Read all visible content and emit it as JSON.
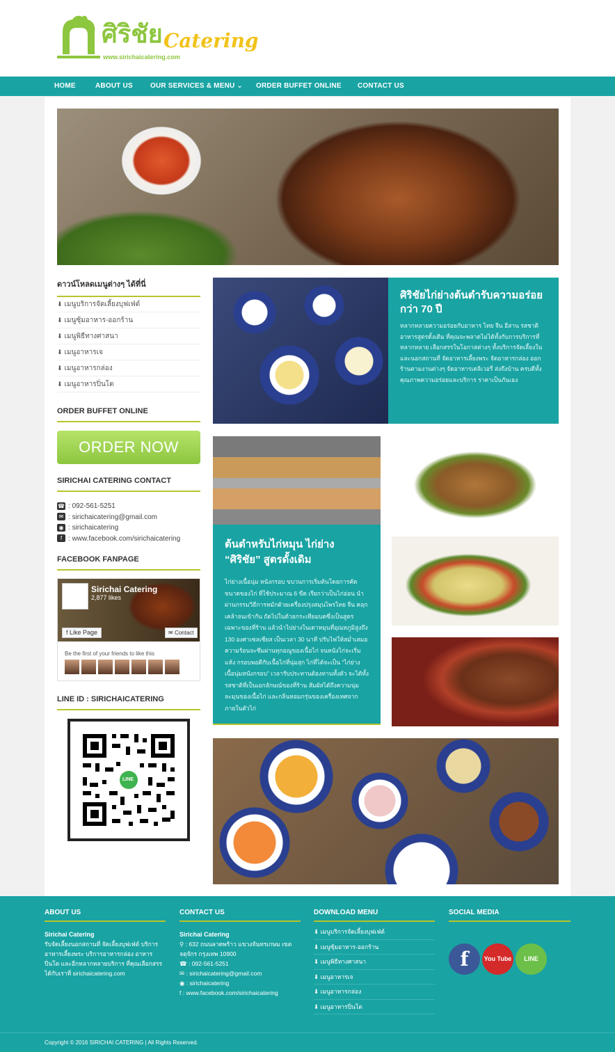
{
  "logo": {
    "thai": "ศิริชัย",
    "english": "Catering",
    "url": "www.sirichaicatering.com"
  },
  "nav": [
    {
      "label": "HOME"
    },
    {
      "label": "ABOUT US"
    },
    {
      "label": "OUR SERVICES & MENU",
      "caret": "⌄"
    },
    {
      "label": "ORDER BUFFET ONLINE"
    },
    {
      "label": "CONTACT US"
    }
  ],
  "sidebar": {
    "download_heading": "ดาวน์โหลดเมนูต่างๆ ได้ที่นี่",
    "download_items": [
      "เมนูบริการจัดเลี้ยงบุฟเฟ่ต์",
      "เมนูซุ้มอาหาร-ออกร้าน",
      "เมนูพิธีทางศาสนา",
      "เมนูอาหารเจ",
      "เมนูอาหารกล่อง",
      "เมนูอาหารปิ่นโต"
    ],
    "order_heading": "ORDER BUFFET ONLINE",
    "order_button": "ORDER NOW",
    "contact_heading": "SIRICHAI CATERING CONTACT",
    "contact": {
      "phone": "092-561-5251",
      "email": "sirichaicatering@gmail.com",
      "line": "sirichaicatering",
      "facebook": "www.facebook.com/sirichaicatering"
    },
    "fanpage_heading": "FACEBOOK FANPAGE",
    "fanpage": {
      "name": "Sirichai Catering",
      "likes": "2,877 likes",
      "like_button": "Like Page",
      "contact_button": "Contact",
      "first_text": "Be the first of your friends to like this"
    },
    "line_heading": "LINE ID : SIRICHAICATERING",
    "qr_badge": "LINE"
  },
  "feature": {
    "title": "ศิริชัยไก่ย่างต้นตำรับความอร่อย กว่า 70 ปี",
    "text": "หลากหลายความอร่อยกับอาหาร ไทย จีน อีสาน รสชาติอาหารสูตรดั้งเดิม ที่คุณจะพลาดไม่ได้ทั้งกับการบริการที่หลากหลาย เลือกสรรในโอกาสต่างๆ ทั้งบริการจัดเลี้ยงในและนอกสถานที่ จัดอาหารเลี้ยงพระ จัดอาหารกล่อง ออกร้านตามงานต่างๆ จัดอาหารเดลิเวอรี่ ส่งถึงบ้าน ครบดีทั้งคุณภาพความอร่อยและบริการ ราคาเป็นกันเอง"
  },
  "chicken": {
    "title": "ต้นตำหรับไก่หมุน ไก่ย่าง “ศิริชัย” สูตรดั้งเดิม",
    "text": "ไก่ย่างเนื้อนุ่ม หนังกรอบ ขบวนการเริ่มต้นโดยการคัดขนาดของไก่ ที่ใช้ประมาณ 6 ขีด เรียกว่าเป็นไก่อ่อน นำผ่านกรรมวิธีการหมักด้วยเครื่องปรุงสมุนไพรไทย จีน คลุกเคล้าจนเข้ากัน ถัดไปในด้วยกระเทียมบดซึ่งเป็นสูตรเฉพาะของที่ร้าน แล้วนำไปย่างในเตาหมุนที่อุณหภูมิสูงถึง 130 องศาเซลเซียส เป็นเวลา 30 นาที ปรับไฟให้สม่ำเสมอ ความร้อนจะซึมผ่านทุกอณูของเนื้อไก่ จนหนังไก่จะเริ่มแห้ง กรอบพอดีกับเนื้อไก่ที่นุ่มสุก ไก่ที่ได้จะเป็น “ไก่ย่างเนื้อนุ่มหนังกรอบ” เวลารับประทานต้องทานทั้งตัว จะได้ทั้งรสชาติที่เป็นเอกลักษณ์ของที่ร้าน สัมผัสได้ถึงความนุ่มละมุนของเนื้อไก่ และกลิ่นหอมกรุ่นของเครื่องเทศจากภายในตัวไก่"
  },
  "footer": {
    "about_heading": "ABOUT US",
    "about_name": "Sirichai Catering",
    "about_text": "รับจัดเลี้ยงนอกสถานที่ จัดเลี้ยงบุฟเฟ่ต์ บริการอาหารเลี้ยงพระ บริการอาหารกล่อง อาหารปิ่นโต และอีกหลากหลายบริการ ที่คุณเลือกสรรได้กับเราที่ sirichaicatering.com",
    "contact_heading": "CONTACT US",
    "contact_name": "Sirichai Catering",
    "address": "632 ถนนลาดพร้าว แขวงจันทรเกษม เขตจตุจักร กรุงเทพ 10900",
    "phone": "092-561-5251",
    "email": "sirichaicatering@gmail.com",
    "line": "sirichaicatering",
    "facebook": "www.facebook.com/sirichaicatering",
    "download_heading": "DOWNLOAD MENU",
    "download_items": [
      "เมนูบริการจัดเลี้ยงบุฟเฟ่ต์",
      "เมนูซุ้มอาหาร-ออกร้าน",
      "เมนูพิธีทางศาสนา",
      "เมนูอาหารเจ",
      "เมนูอาหารกล่อง",
      "เมนูอาหารปิ่นโต"
    ],
    "social_heading": "SOCIAL MEDIA",
    "social": {
      "facebook": "f",
      "youtube": "You Tube",
      "line": "LINE"
    }
  },
  "copyright": "Copyright © 2016 SIRICHAI CATERING | All Rights Reserved.",
  "colors": {
    "teal": "#1aa3a3",
    "lime": "#8dc63f",
    "accent_line": "#b8c42a",
    "gold": "#f2c21a"
  }
}
